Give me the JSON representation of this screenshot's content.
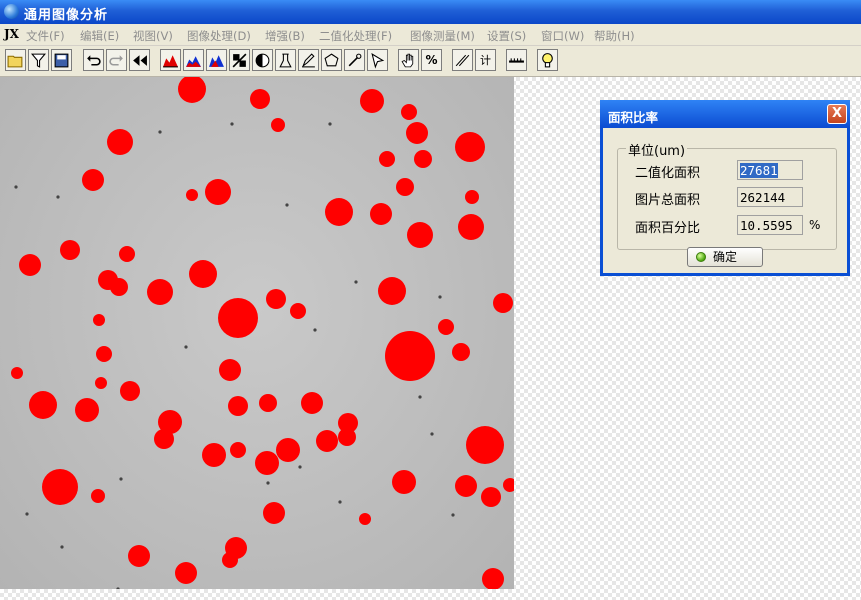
{
  "window": {
    "title": "通用图像分析"
  },
  "menubar": {
    "logo": "JX",
    "items": [
      "文件(F)",
      "编辑(E)",
      "视图(V)",
      "图像处理(D)",
      "增强(B)",
      "二值化处理(F)",
      "图像测量(M)",
      "设置(S)",
      "窗口(W)",
      "帮助(H)"
    ]
  },
  "toolbar": {
    "icons": [
      "open-folder-icon",
      "filter-icon",
      "save-icon",
      "undo-icon",
      "redo-icon",
      "rewind-icon",
      "histogram-icon",
      "histogram-blue-icon",
      "histogram-mixed-icon",
      "invert-icon",
      "contrast-icon",
      "beaker-icon",
      "pen-icon",
      "polygon-icon",
      "wand-icon",
      "pointer-icon",
      "hand-icon",
      "percent-icon",
      "line-icon",
      "count-icon",
      "ruler-icon",
      "bulb-icon"
    ],
    "percent_label": "%",
    "count_label": "计"
  },
  "dialog": {
    "title": "面积比率",
    "close_label": "X",
    "group_label": "单位(um)",
    "rows": [
      {
        "label": "二值化面积",
        "value": "27681",
        "unit": ""
      },
      {
        "label": "图片总面积",
        "value": "262144",
        "unit": ""
      },
      {
        "label": "面积百分比",
        "value": "10.5595",
        "unit": "%"
      }
    ],
    "ok_label": "确定"
  },
  "colors": {
    "title_bar": "#1f5fd6",
    "particle": "#ff0000",
    "selection": "#316ac5",
    "menu_disabled": "#8e8e8e"
  }
}
